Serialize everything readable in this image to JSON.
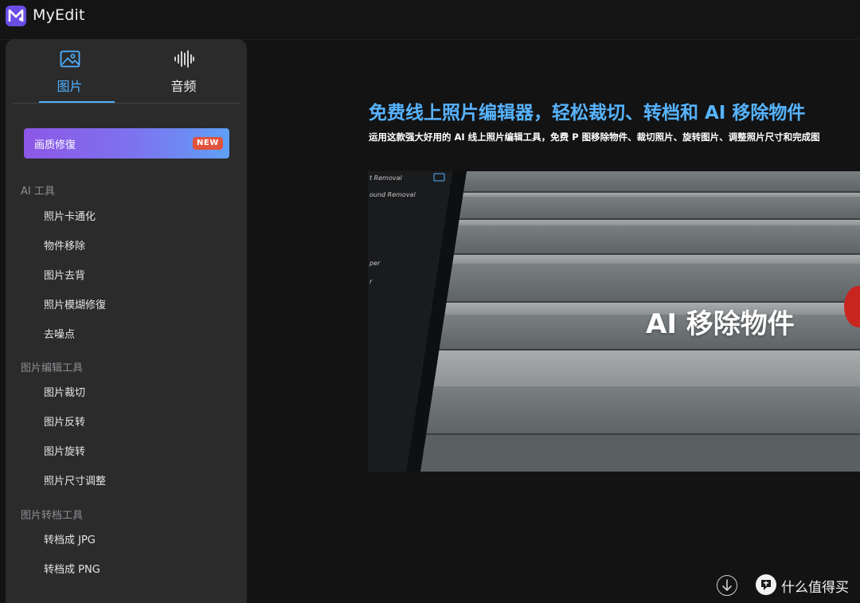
{
  "app": {
    "title": "MyEdit"
  },
  "tabs": [
    {
      "label": "图片",
      "icon": "image-icon",
      "active": true
    },
    {
      "label": "音频",
      "icon": "audio-wave-icon",
      "active": false
    }
  ],
  "promo": {
    "label": "画质修復",
    "badge": "NEW"
  },
  "sections": [
    {
      "title": "AI 工具",
      "items": [
        "照片卡通化",
        "物件移除",
        "图片去背",
        "照片模煳修復",
        "去噪点"
      ]
    },
    {
      "title": "图片编辑工具",
      "items": [
        "图片裁切",
        "图片反转",
        "图片旋转",
        "照片尺寸调整"
      ]
    },
    {
      "title": "图片转档工具",
      "items": [
        "转档成 JPG",
        "转档成 PNG"
      ]
    }
  ],
  "main": {
    "headline": "免费线上照片编辑器，轻松裁切、转档和 AI 移除物件",
    "subline": "运用这款强大好用的 AI 线上照片编辑工具，免费 P 图移除物件、裁切照片、旋转图片、调整照片尺寸和完成图",
    "hero": {
      "overlay_text": "AI 移除物件",
      "panel_labels": [
        "t Removal",
        "ound Removal",
        "per",
        "r"
      ]
    }
  },
  "footer": {
    "scroll_icon": "arrow-down-circle-icon",
    "watermark_icon": "smzdm-logo-icon",
    "watermark_text": "什么值得买"
  },
  "colors": {
    "accent": "#4fb0ff",
    "badge": "#e0533e",
    "sidebar": "#2b2b2c",
    "background": "#131313"
  }
}
